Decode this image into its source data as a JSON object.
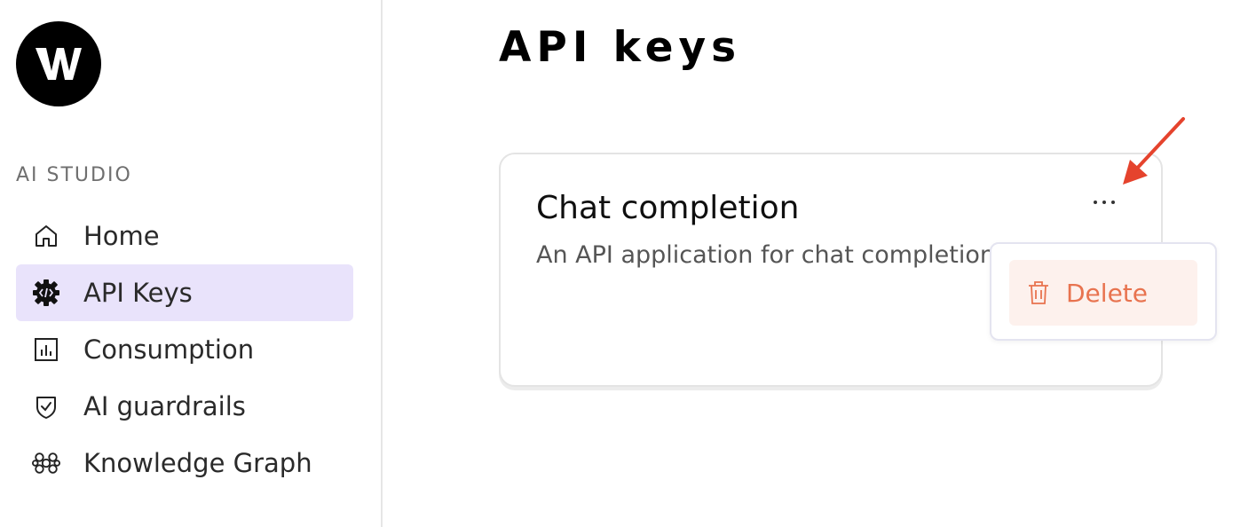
{
  "sidebar": {
    "logo_text": "W",
    "section_label": "AI STUDIO",
    "items": [
      {
        "label": "Home",
        "icon": "home-icon"
      },
      {
        "label": "API Keys",
        "icon": "api-gear-icon",
        "active": true
      },
      {
        "label": "Consumption",
        "icon": "chart-icon"
      },
      {
        "label": "AI guardrails",
        "icon": "shield-check-icon"
      },
      {
        "label": "Knowledge Graph",
        "icon": "graph-icon"
      }
    ]
  },
  "main": {
    "title": "API keys",
    "card": {
      "title": "Chat completion",
      "description": "An API application for chat completion",
      "more_label": "···"
    },
    "menu": {
      "delete_label": "Delete",
      "delete_icon": "trash-icon"
    }
  },
  "colors": {
    "active_bg": "#e9e3fb",
    "danger": "#e8734f",
    "danger_bg": "#fdf1ed",
    "annotation_arrow": "#e5432d"
  }
}
